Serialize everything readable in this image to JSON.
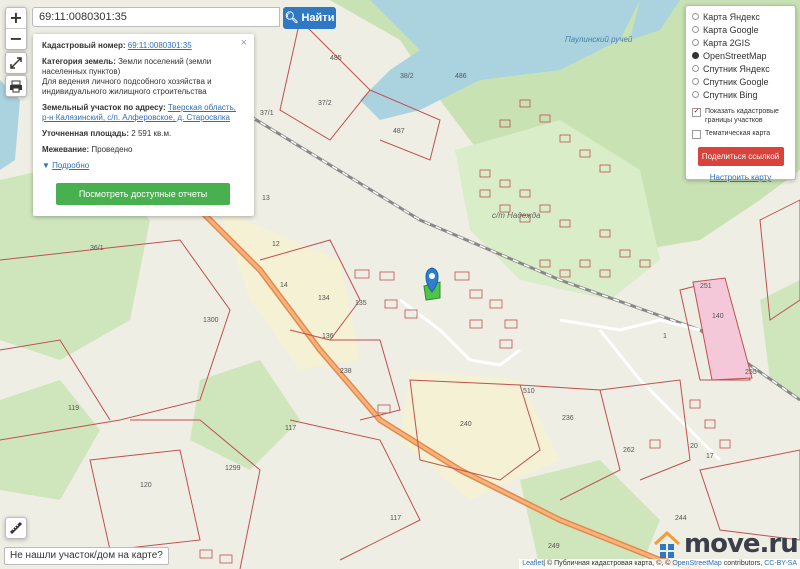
{
  "search": {
    "value": "69:11:0080301:35",
    "button_label": "Найти"
  },
  "zoom": {
    "in": "+",
    "out": "−"
  },
  "info": {
    "cadastral_label": "Кадастровый номер:",
    "cadastral_value": "69:11:0080301:35",
    "category_label": "Категория земель:",
    "category_value": "Земли поселений (земли населенных пунктов)",
    "usage_value": "Для ведения личного подсобного хозяйства и индивидуального жилищного строительства",
    "address_label": "Земельный участок по адресу:",
    "address_value": "Тверская область, р-н Калязинский, с/п. Алферовское, д. Старосвлка",
    "area_label": "Уточненная площадь:",
    "area_value": "2 591 кв.м.",
    "survey_label": "Межевание:",
    "survey_value": "Проведено",
    "more_label": "Подробно",
    "report_button": "Посмотреть доступные отчеты",
    "close": "×"
  },
  "layers": {
    "options": [
      "Карта Яндекс",
      "Карта Google",
      "Карта 2GIS",
      "OpenStreetMap",
      "Спутник Яндекс",
      "Спутник Google",
      "Спутник Bing"
    ],
    "selected": "OpenStreetMap",
    "check_cadastral": "Показать кадастровые границы участков",
    "check_thematic": "Тематическая карта",
    "share_button": "Поделиться ссылкой",
    "setup_link": "Настроить карту"
  },
  "notfound": "Не нашли участок/дом на карте?",
  "attribution": {
    "leaflet": "Leaflet",
    "text": "| © Публичная кадастровая карта, ©, © ",
    "osm": "OpenStreetMap",
    "contrib": " contributors, ",
    "license": "CC-BY-SA"
  },
  "logo": "move.ru",
  "map_labels": {
    "brook": "Паулинский ручей",
    "settlement": "с/т Надежда",
    "numbers": [
      "485",
      "38/2",
      "486",
      "487",
      "37/2",
      "37/1",
      "36/1",
      "13",
      "12",
      "14",
      "134",
      "135",
      "136",
      "238",
      "1300",
      "119",
      "117",
      "120",
      "1299",
      "240",
      "236",
      "510",
      "262",
      "140",
      "1",
      "251",
      "255",
      "249",
      "244",
      "117",
      "20",
      "17"
    ]
  },
  "colors": {
    "water": "#aad3df",
    "forest": "#c8e2b4",
    "field": "#f2efd8",
    "road": "#e48a4a",
    "parcel": "#c05050",
    "accent": "#2e78c4"
  }
}
